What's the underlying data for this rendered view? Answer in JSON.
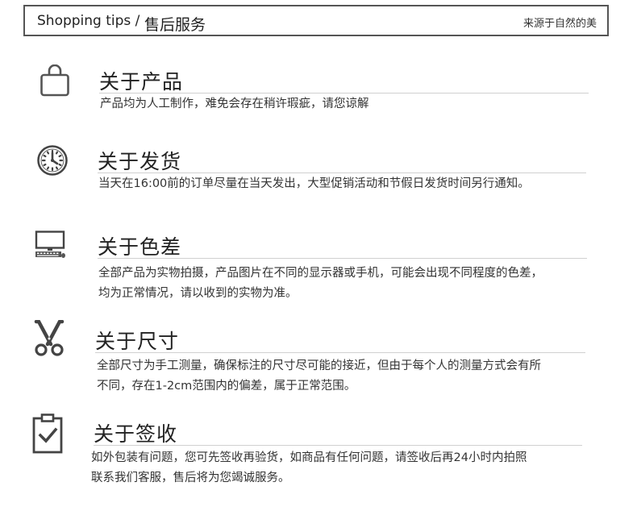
{
  "header": {
    "prefix": "Shopping tips /",
    "title": "售后服务",
    "tagline": "来源于自然的美"
  },
  "sections": [
    {
      "icon": "shopping-bag-icon",
      "title": "关于产品",
      "lines": [
        "产品均为人工制作，难免会存在稍许瑕疵，请您谅解"
      ]
    },
    {
      "icon": "clock-icon",
      "title": "关于发货",
      "lines": [
        "当天在16:00前的订单尽量在当天发出，大型促销活动和节假日发货时间另行通知。"
      ]
    },
    {
      "icon": "computer-icon",
      "title": "关于色差",
      "lines": [
        "全部产品为实物拍摄，产品图片在不同的显示器或手机，可能会出现不同程度的色差，",
        "均为正常情况，请以收到的实物为准。"
      ]
    },
    {
      "icon": "scissors-icon",
      "title": "关于尺寸",
      "lines": [
        "全部尺寸为手工测量，确保标注的尺寸尽可能的接近，但由于每个人的测量方式会有所",
        "不同，存在1-2cm范围内的偏差，属于正常范围。"
      ]
    },
    {
      "icon": "clipboard-check-icon",
      "title": "关于签收",
      "lines": [
        "如外包装有问题，您可先签收再验货，如商品有任何问题，请签收后再24小时内拍照",
        "联系我们客服，售后将为您竭诚服务。"
      ]
    }
  ]
}
